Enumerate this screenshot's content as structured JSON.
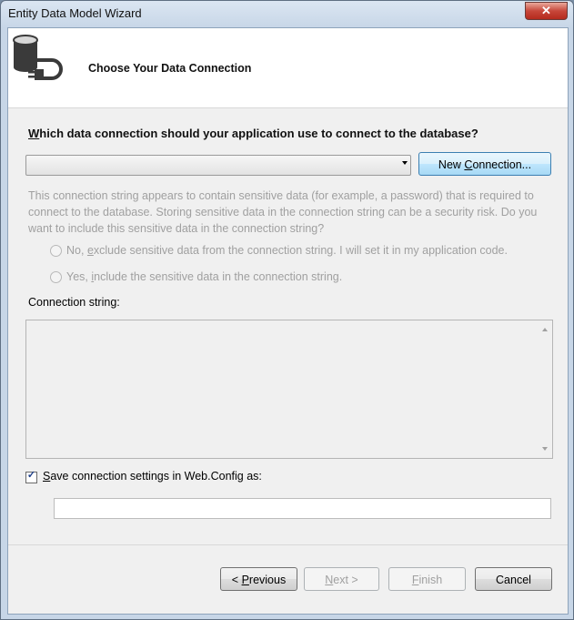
{
  "window": {
    "title": "Entity Data Model Wizard",
    "close_glyph": "✕"
  },
  "header": {
    "title": "Choose Your Data Connection",
    "icon": "database-plug-icon"
  },
  "connection": {
    "question_prefix": "W",
    "question_rest": "hich data connection should your application use to connect to the database?",
    "selected_value": "",
    "new_connection_prefix": "New ",
    "new_connection_accel": "C",
    "new_connection_suffix": "onnection..."
  },
  "sensitive": {
    "description": "This connection string appears to contain sensitive data (for example, a password) that is required to connect to the database. Storing sensitive data in the connection string can be a security risk. Do you want to include this sensitive data in the connection string?",
    "option_no_prefix": "No, ",
    "option_no_accel": "e",
    "option_no_suffix": "xclude sensitive data from the connection string. I will set it in my application code.",
    "option_yes_prefix": "Yes, ",
    "option_yes_accel": "i",
    "option_yes_suffix": "nclude the sensitive data in the connection string."
  },
  "connection_string": {
    "label": "Connection string:",
    "value": ""
  },
  "save_settings": {
    "checked": true,
    "label_accel": "S",
    "label_rest": "ave connection settings in Web.Config as:",
    "value": ""
  },
  "buttons": {
    "previous_prefix": "< ",
    "previous_accel": "P",
    "previous_suffix": "revious",
    "next_accel": "N",
    "next_suffix": "ext >",
    "finish_accel": "F",
    "finish_suffix": "inish",
    "cancel": "Cancel"
  }
}
